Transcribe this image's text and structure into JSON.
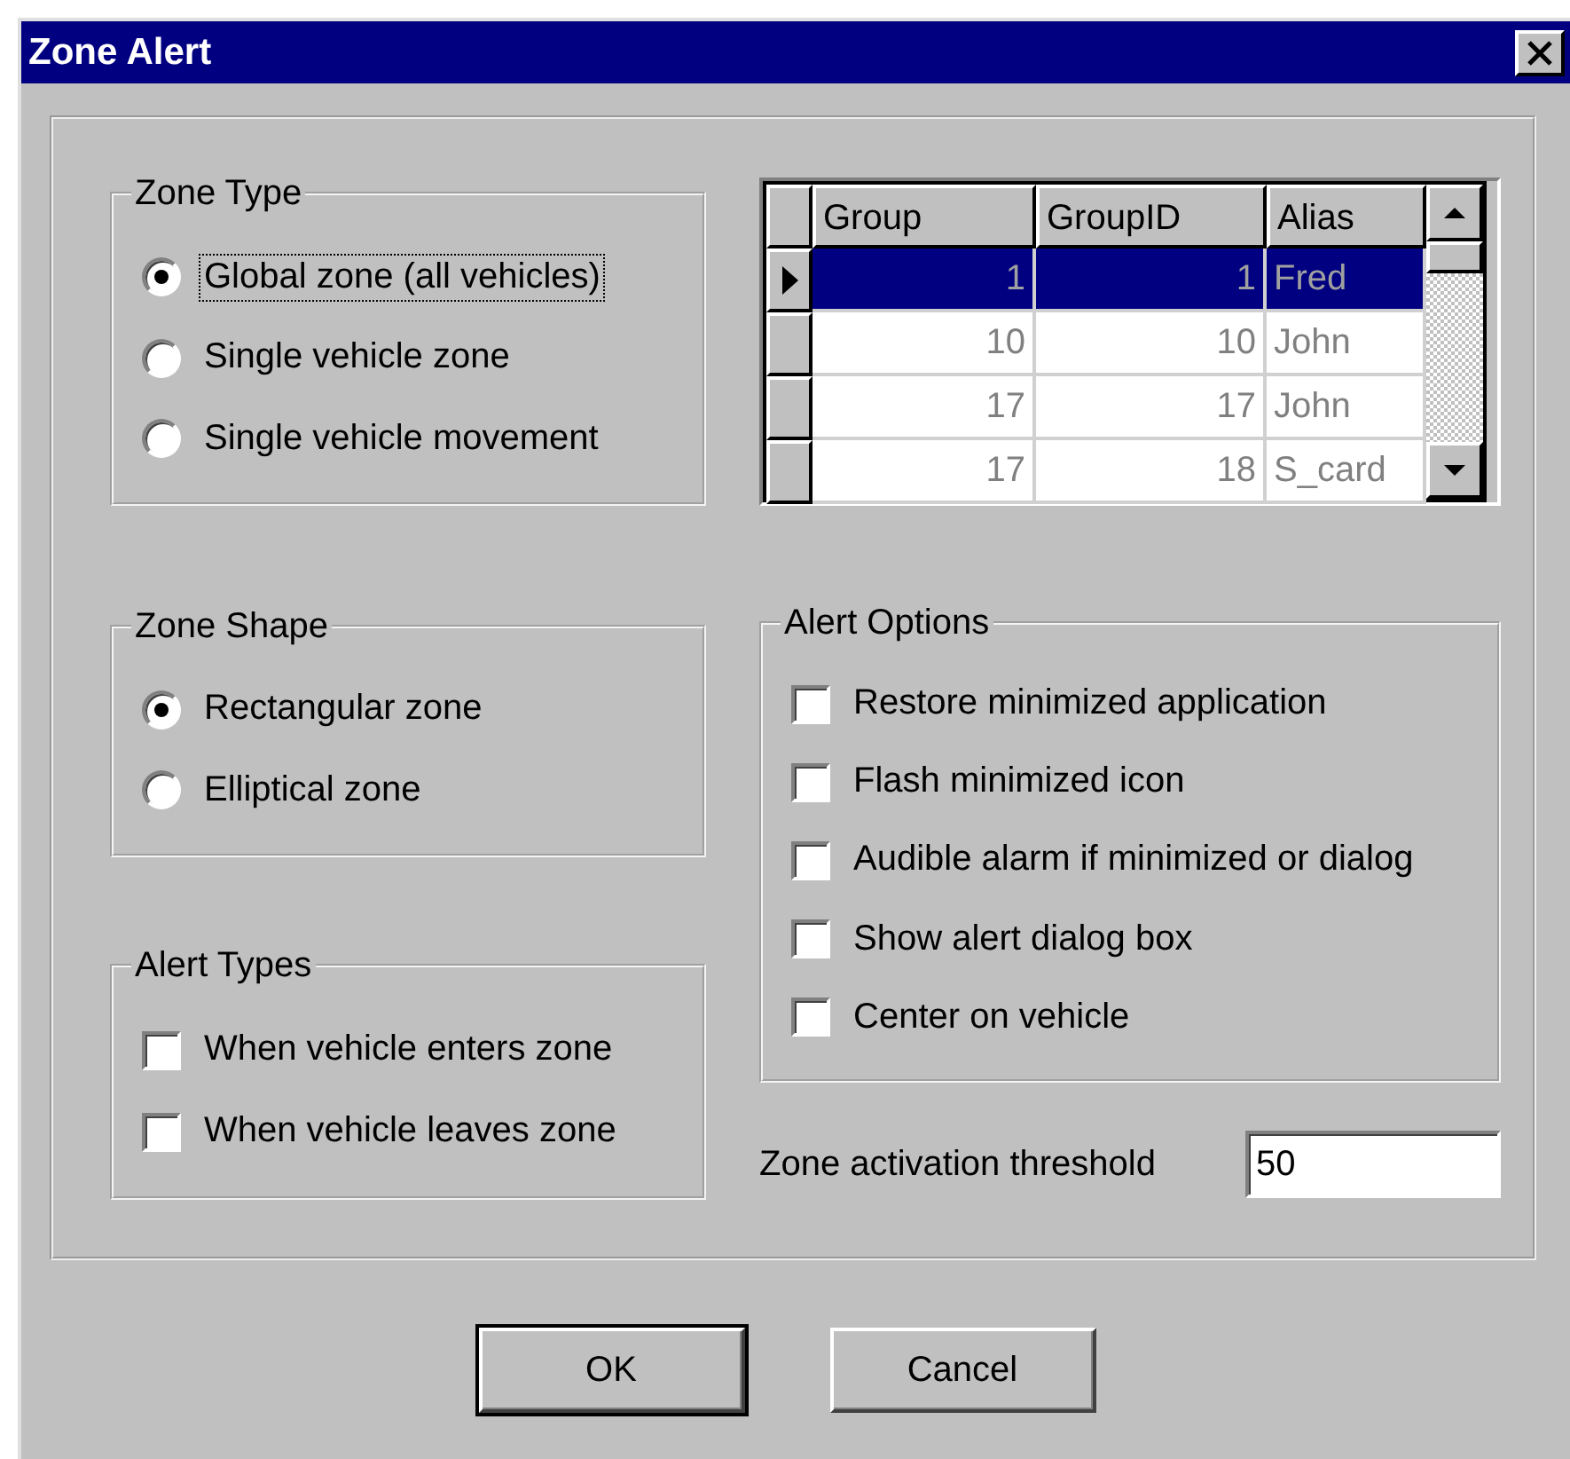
{
  "window": {
    "title": "Zone Alert"
  },
  "zone_type": {
    "label": "Zone Type",
    "options": [
      {
        "label": "Global zone (all vehicles)",
        "selected": true,
        "focused": true
      },
      {
        "label": "Single vehicle zone",
        "selected": false,
        "focused": false
      },
      {
        "label": "Single vehicle movement",
        "selected": false,
        "focused": false
      }
    ]
  },
  "grid": {
    "columns": [
      "Group",
      "GroupID",
      "Alias"
    ],
    "rows": [
      {
        "cells": [
          "1",
          "1",
          "Fred"
        ],
        "selected": true
      },
      {
        "cells": [
          "10",
          "10",
          "John"
        ],
        "selected": false
      },
      {
        "cells": [
          "17",
          "17",
          "John"
        ],
        "selected": false
      },
      {
        "cells": [
          "17",
          "18",
          "S_card"
        ],
        "selected": false
      }
    ]
  },
  "zone_shape": {
    "label": "Zone Shape",
    "options": [
      {
        "label": "Rectangular zone",
        "selected": true,
        "focused": false
      },
      {
        "label": "Elliptical zone",
        "selected": false,
        "focused": false
      }
    ]
  },
  "alert_options": {
    "label": "Alert Options",
    "items": [
      {
        "label": "Restore minimized application",
        "checked": false
      },
      {
        "label": "Flash minimized icon",
        "checked": false
      },
      {
        "label": "Audible alarm if minimized or dialog",
        "checked": false
      },
      {
        "label": "Show alert dialog box",
        "checked": false
      },
      {
        "label": "Center on vehicle",
        "checked": false
      }
    ]
  },
  "alert_types": {
    "label": "Alert Types",
    "items": [
      {
        "label": "When vehicle enters zone",
        "checked": false
      },
      {
        "label": "When vehicle leaves zone",
        "checked": false
      }
    ]
  },
  "threshold": {
    "label": "Zone activation threshold",
    "value": "50"
  },
  "buttons": [
    {
      "label": "OK",
      "default": true
    },
    {
      "label": "Cancel",
      "default": false
    }
  ]
}
